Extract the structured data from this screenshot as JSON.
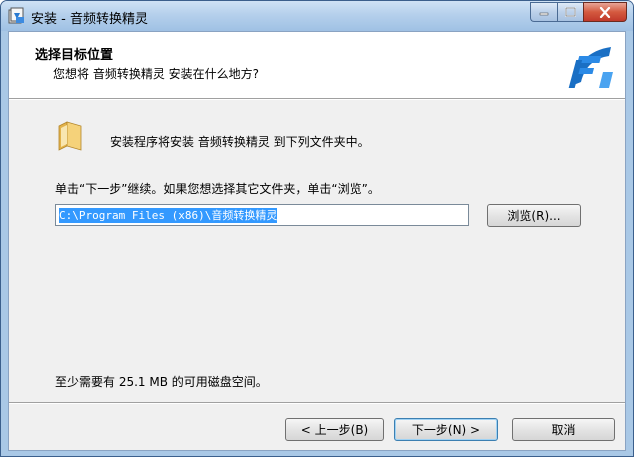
{
  "window": {
    "title": "安装 - 音频转换精灵",
    "controls": {
      "minimize_icon": "minimize-icon",
      "maximize_icon": "maximize-icon",
      "close_icon": "close-icon"
    }
  },
  "header": {
    "title": "选择目标位置",
    "subtitle": "您想将 音频转换精灵 安装在什么地方?"
  },
  "body": {
    "info_line": "安装程序将安装 音频转换精灵 到下列文件夹中。",
    "instruction": "单击“下一步”继续。如果您想选择其它文件夹，单击“浏览”。",
    "path_value": "C:\\Program Files (x86)\\音频转换精灵",
    "browse_label": "浏览(R)...",
    "space_text": "至少需要有 25.1 MB 的可用磁盘空间。"
  },
  "footer": {
    "back_label": "< 上一步(B)",
    "next_label": "下一步(N) >",
    "cancel_label": "取消"
  },
  "colors": {
    "titlebar": "#b5d0ec",
    "selection": "#3399ff",
    "logo_blue": "#1a6fc4"
  }
}
